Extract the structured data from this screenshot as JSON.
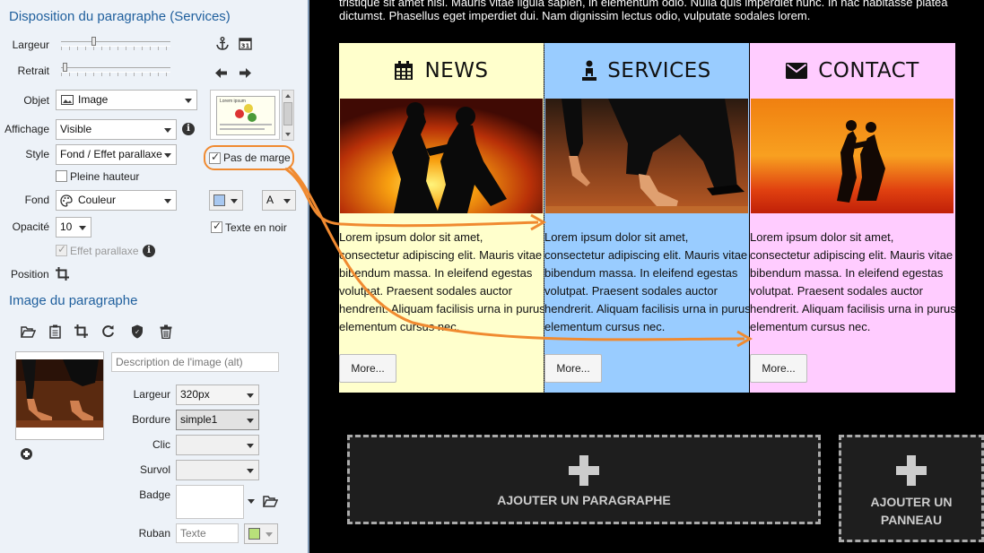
{
  "panel": {
    "title": "Disposition du paragraphe (Services)",
    "labels": {
      "largeur": "Largeur",
      "retrait": "Retrait",
      "objet": "Objet",
      "affichage": "Affichage",
      "style": "Style",
      "fond": "Fond",
      "opacite": "Opacité",
      "position": "Position"
    },
    "objet_value": "Image",
    "affichage_value": "Visible",
    "style_value": "Fond / Effet parallaxe",
    "pleine_hauteur": "Pleine hauteur",
    "pas_de_marge": "Pas de marge",
    "fond_value": "Couleur",
    "font_letter": "A",
    "opacite_value": "10",
    "texte_en_noir": "Texte en noir",
    "effet_parallaxe": "Effet parallaxe",
    "fond_color": "#a8c8f0",
    "preview_caption": "Lorem ipsum"
  },
  "image_section": {
    "title": "Image du paragraphe",
    "alt_placeholder": "Description de l'image (alt)",
    "largeur_label": "Largeur",
    "largeur_value": "320px",
    "bordure_label": "Bordure",
    "bordure_value": "simple1",
    "clic_label": "Clic",
    "survol_label": "Survol",
    "badge_label": "Badge",
    "ruban_label": "Ruban",
    "ruban_placeholder": "Texte",
    "ruban_color": "#b8e07a"
  },
  "stage": {
    "intro_line1": "tristique sit amet nisi. Mauris vitae ligula sapien, in elementum odio. Nulla quis imperdiet nunc. In hac habitasse platea",
    "intro_line2": "dictumst. Phasellus eget imperdiet dui. Nam dignissim lectus odio, vulputate sodales lorem.",
    "columns": [
      {
        "title": "NEWS",
        "icon": "calendar-icon",
        "bg": "#ffffcc",
        "text": "Lorem ipsum dolor sit amet,\nconsectetur adipiscing elit. Mauris vitae\nbibendum massa. In eleifend egestas\nvolutpat. Praesent sodales auctor\nhendrerit. Aliquam facilisis urna in purus\nelementum cursus nec.",
        "button": "More..."
      },
      {
        "title": "SERVICES",
        "icon": "person-icon",
        "bg": "#99ccff",
        "text": "Lorem ipsum dolor sit amet,\nconsectetur adipiscing elit. Mauris vitae\nbibendum massa. In eleifend egestas\nvolutpat. Praesent sodales auctor\nhendrerit. Aliquam facilisis urna in purus\nelementum cursus nec.",
        "button": "More..."
      },
      {
        "title": "CONTACT",
        "icon": "envelope-icon",
        "bg": "#ffccff",
        "text": "Lorem ipsum dolor sit amet,\nconsectetur adipiscing elit. Mauris vitae\nbibendum massa. In eleifend egestas\nvolutpat. Praesent sodales auctor\nhendrerit. Aliquam facilisis urna in purus\nelementum cursus nec.",
        "button": "More..."
      }
    ],
    "add_paragraph": "AJOUTER UN PARAGRAPHE",
    "add_panel_line1": "AJOUTER UN",
    "add_panel_line2": "PANNEAU",
    "annotation_color": "#f08a30"
  }
}
